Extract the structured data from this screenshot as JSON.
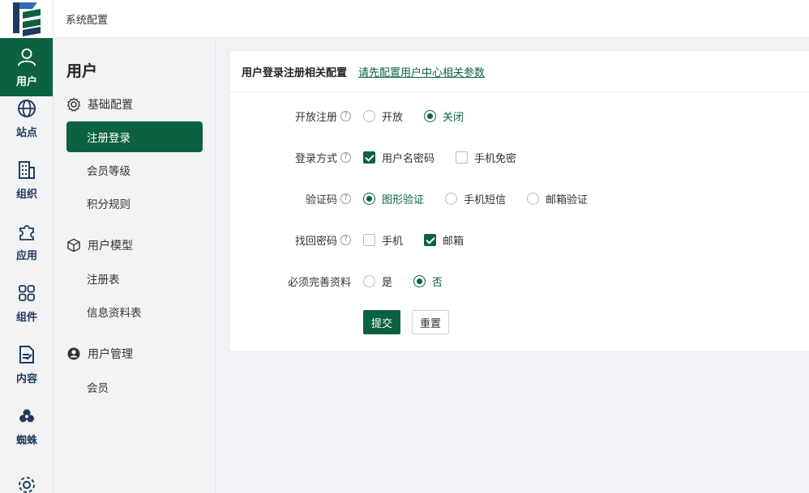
{
  "topbar": {
    "title": "系统配置"
  },
  "rail": {
    "items": [
      {
        "label": "用户",
        "icon": "user-icon",
        "active": true
      },
      {
        "label": "站点",
        "icon": "globe-icon"
      },
      {
        "label": "组织",
        "icon": "building-icon"
      },
      {
        "label": "应用",
        "icon": "puzzle-icon"
      },
      {
        "label": "组件",
        "icon": "grid-icon"
      },
      {
        "label": "内容",
        "icon": "document-icon"
      },
      {
        "label": "蜘蛛",
        "icon": "spider-icon"
      },
      {
        "label": "",
        "icon": "gear-icon"
      }
    ]
  },
  "sidebar": {
    "title": "用户",
    "groups": [
      {
        "label": "基础配置",
        "icon": "gear-icon",
        "items": [
          "注册登录",
          "会员等级",
          "积分规则"
        ]
      },
      {
        "label": "用户模型",
        "icon": "cube-icon",
        "items": [
          "注册表",
          "信息资料表"
        ]
      },
      {
        "label": "用户管理",
        "icon": "user-circle-icon",
        "items": [
          "会员"
        ]
      }
    ]
  },
  "panel": {
    "title": "用户登录注册相关配置",
    "link": "请先配置用户中心相关参数",
    "fields": [
      {
        "label": "开放注册",
        "help": "?",
        "type": "radio",
        "options": [
          "开放",
          "关闭"
        ],
        "selected": [
          1
        ]
      },
      {
        "label": "登录方式",
        "help": "?",
        "type": "checkbox",
        "options": [
          "用户名密码",
          "手机免密"
        ],
        "selected": [
          0
        ]
      },
      {
        "label": "验证码",
        "help": "?",
        "type": "radio",
        "options": [
          "图形验证",
          "手机短信",
          "邮箱验证"
        ],
        "selected": [
          0
        ]
      },
      {
        "label": "找回密码",
        "help": "?",
        "type": "checkbox",
        "options": [
          "手机",
          "邮箱"
        ],
        "selected": [
          1
        ]
      },
      {
        "label": "必须完善资料",
        "help": "",
        "type": "radio",
        "options": [
          "是",
          "否"
        ],
        "selected": [
          1
        ]
      }
    ],
    "submit_label": "提交",
    "reset_label": "重置"
  },
  "colors": {
    "primary": "#0b6140",
    "rail_icon": "#1f3a5f"
  }
}
